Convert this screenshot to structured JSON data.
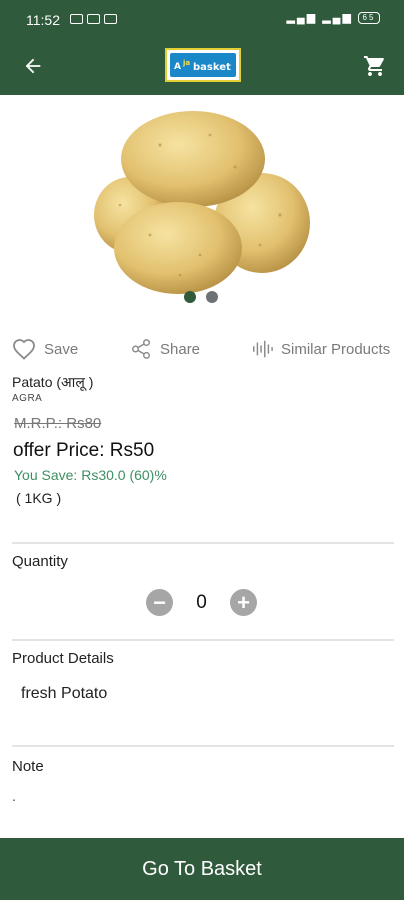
{
  "status_bar": {
    "time": "11:52",
    "left_icons": "✈ ✉ ■ •",
    "right_icons": "↑↓ ☰ .▮ ☰ ▮",
    "battery": "65"
  },
  "app_bar": {
    "logo_text": "Aja Basket"
  },
  "product": {
    "name": "Patato (आलू )",
    "origin": "AGRA",
    "mrp": "M.R.P.: Rs80",
    "offer_price": "offer Price: Rs50",
    "you_save": "You Save: Rs30.0 (60)%",
    "unit": "( 1KG )"
  },
  "actions": {
    "save_label": "Save",
    "share_label": "Share",
    "similar_label": "Similar Products"
  },
  "quantity": {
    "label": "Quantity",
    "value": "0",
    "minus_symbol": "−",
    "plus_symbol": "+"
  },
  "details": {
    "label": "Product Details",
    "text": "fresh Potato"
  },
  "note": {
    "label": "Note",
    "text": "."
  },
  "bottom_button": {
    "label": "Go To Basket"
  },
  "colors": {
    "primary": "#2f5a3b",
    "savings": "#3f8e63",
    "stepper": "#a6a6a6"
  },
  "carousel": {
    "active_index": 0,
    "count": 2
  }
}
